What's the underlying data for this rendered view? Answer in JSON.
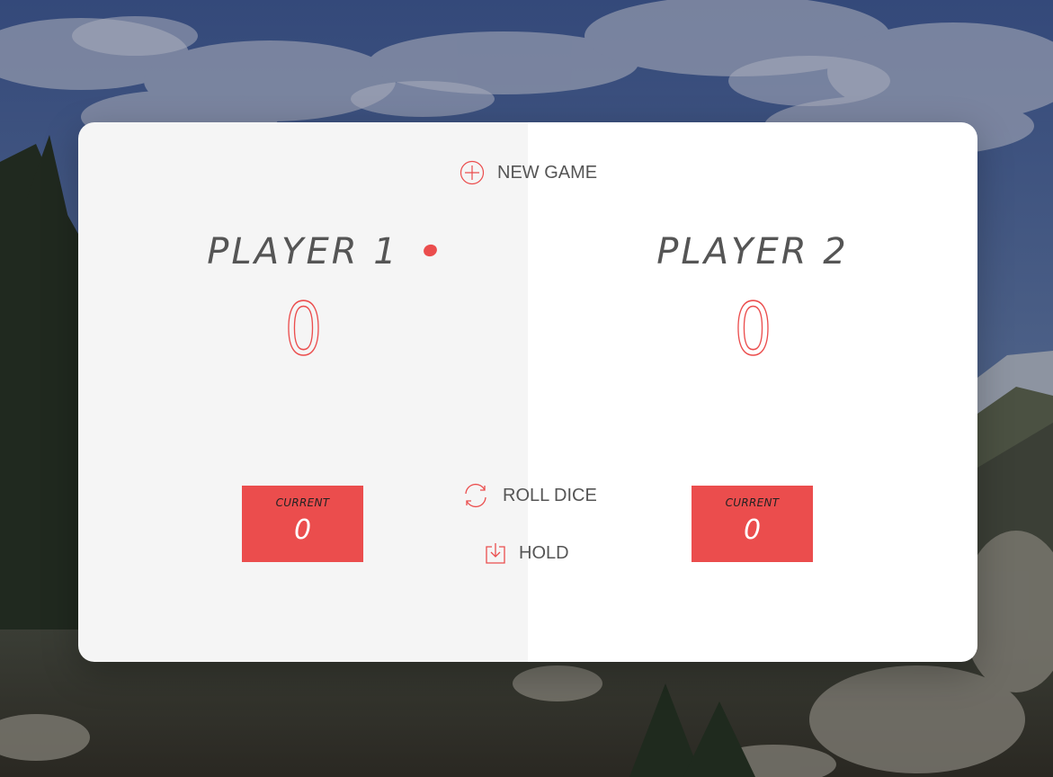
{
  "controls": {
    "new_game": "NEW GAME",
    "roll_dice": "ROLL DICE",
    "hold": "HOLD"
  },
  "players": [
    {
      "name": "PLAYER 1",
      "score": "0",
      "current_label": "CURRENT",
      "current_score": "0",
      "active": true
    },
    {
      "name": "PLAYER 2",
      "score": "0",
      "current_label": "CURRENT",
      "current_score": "0",
      "active": false
    }
  ],
  "colors": {
    "accent": "#eb4d4d",
    "panel_left": "#f5f5f5",
    "panel_right": "#ffffff",
    "text": "#555555"
  },
  "icons": {
    "new_game": "plus-circle-icon",
    "roll_dice": "refresh-icon",
    "hold": "download-icon",
    "active_player": "active-dot-icon"
  }
}
